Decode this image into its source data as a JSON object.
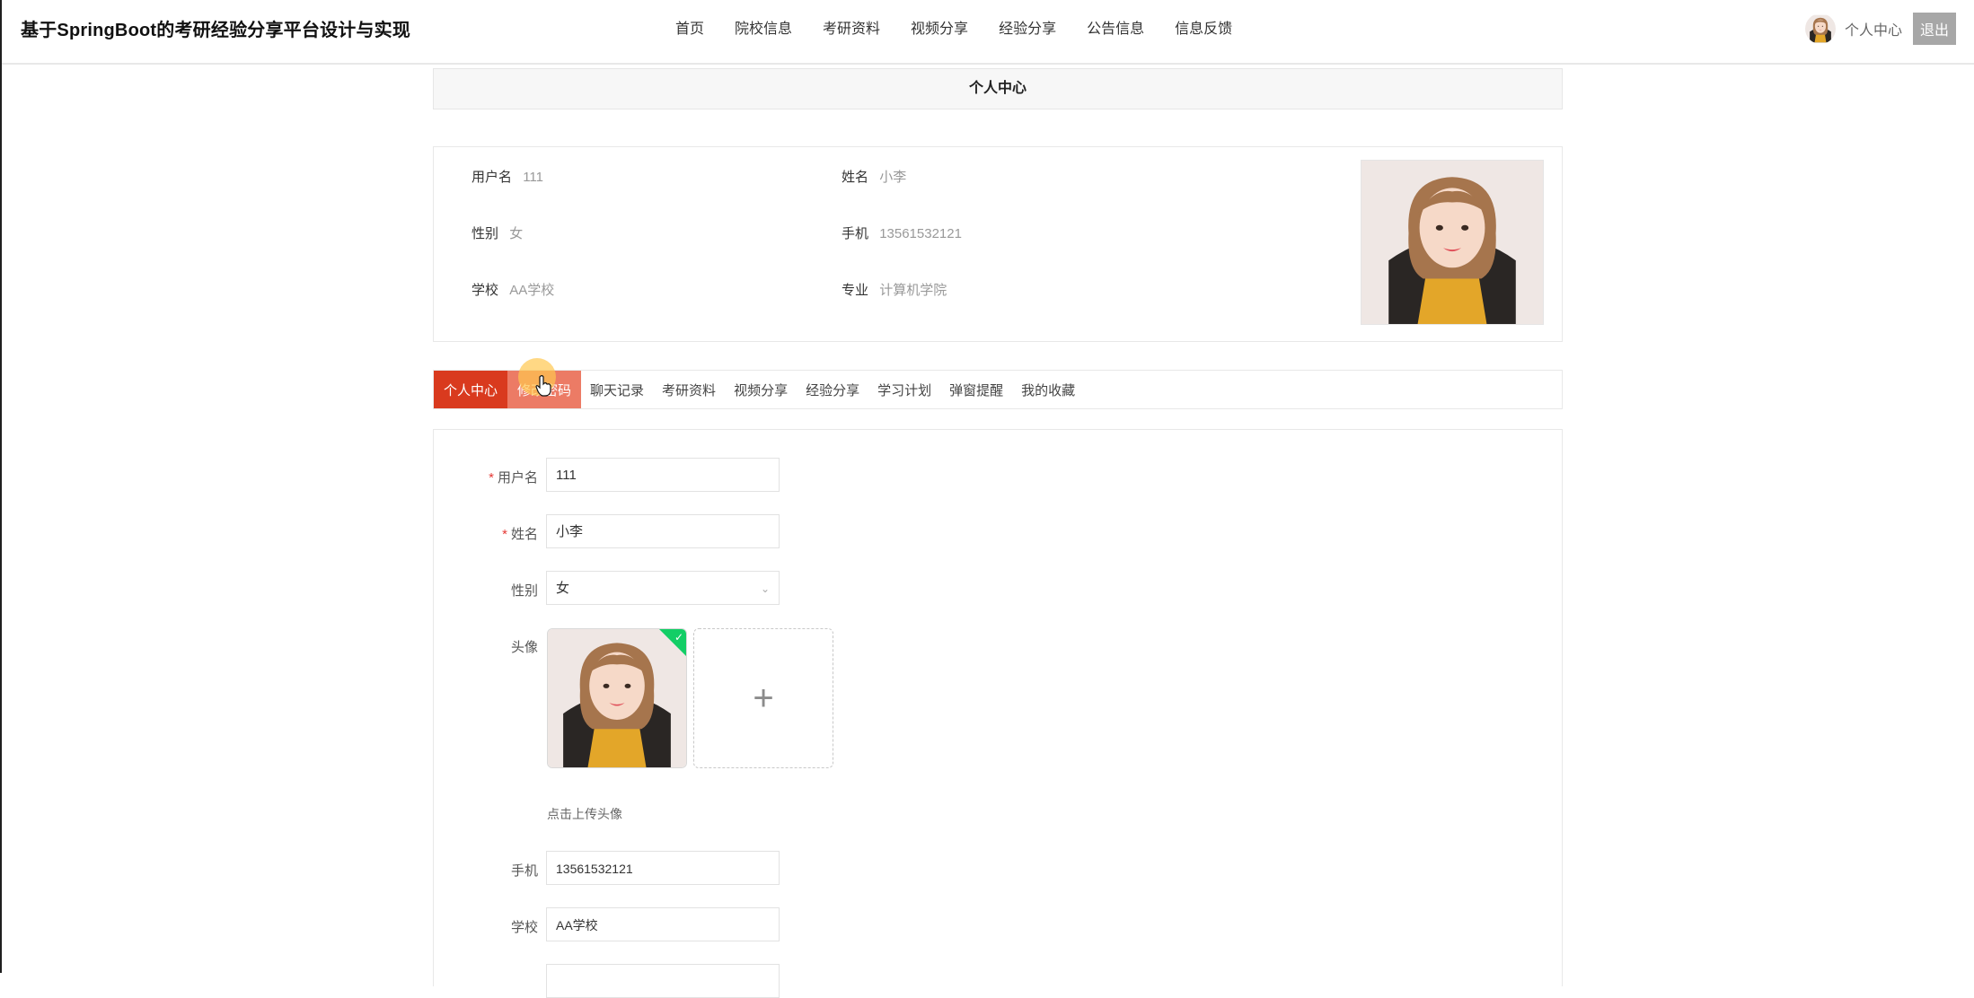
{
  "header": {
    "site_title": "基于SpringBoot的考研经验分享平台设计与实现",
    "nav": [
      "首页",
      "院校信息",
      "考研资料",
      "视频分享",
      "经验分享",
      "公告信息",
      "信息反馈"
    ],
    "user_link": "个人中心",
    "logout": "退出"
  },
  "banner": {
    "title": "个人中心"
  },
  "profile": {
    "username_label": "用户名",
    "username": "111",
    "name_label": "姓名",
    "name": "小李",
    "gender_label": "性别",
    "gender": "女",
    "phone_label": "手机",
    "phone": "13561532121",
    "school_label": "学校",
    "school": "AA学校",
    "major_label": "专业",
    "major": "计算机学院"
  },
  "tabs": [
    "个人中心",
    "修改密码",
    "聊天记录",
    "考研资料",
    "视频分享",
    "经验分享",
    "学习计划",
    "弹窗提醒",
    "我的收藏"
  ],
  "form": {
    "username_label": "用户名",
    "username": "111",
    "name_label": "姓名",
    "name": "小李",
    "gender_label": "性别",
    "gender": "女",
    "avatar_label": "头像",
    "upload_tip": "点击上传头像",
    "phone_label": "手机",
    "phone": "13561532121",
    "school_label": "学校",
    "school": "AA学校",
    "required_mark": "*",
    "add_icon": "+"
  },
  "icons": {
    "avatar": "avatar-photo",
    "upload_ok": "check-icon",
    "select": "chevron-down-icon",
    "cursor": "hand-pointer-icon"
  },
  "colors": {
    "active_tab": "#d93a1e",
    "hover_tab": "#ec7b65",
    "upload_ok": "#13ce66",
    "logout_bg": "#a7a7a7"
  }
}
